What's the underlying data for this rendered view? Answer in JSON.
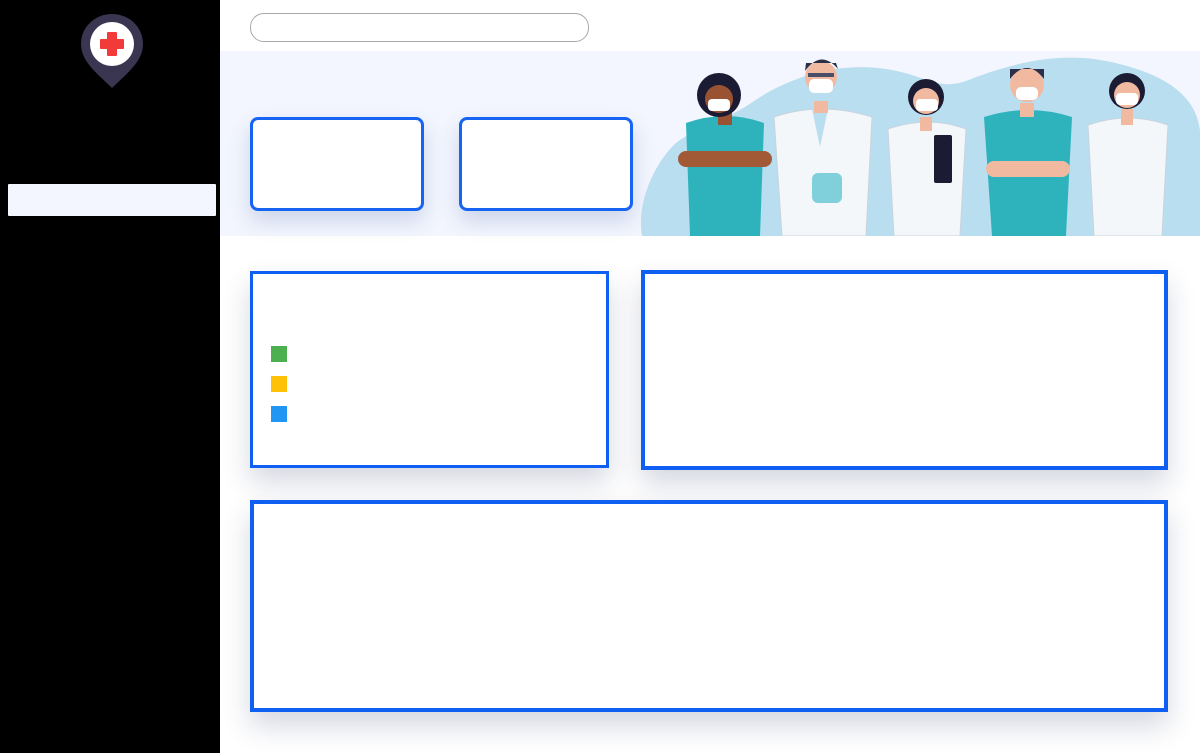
{
  "app": {
    "brand_color": "#0f60f2",
    "sidebar_color": "#000000",
    "banner_bg": "#f3f6fe"
  },
  "sidebar": {
    "logo_icon": "map-pin-medical-cross-icon",
    "active_item": {
      "label": ""
    }
  },
  "search": {
    "placeholder": "",
    "value": ""
  },
  "stats": [
    {
      "label": "",
      "value": ""
    },
    {
      "label": "",
      "value": ""
    }
  ],
  "chart_card": {
    "title": "",
    "legend": [
      {
        "label": "",
        "color": "#4caf50"
      },
      {
        "label": "",
        "color": "#ffc107"
      },
      {
        "label": "",
        "color": "#2196f3"
      }
    ]
  },
  "right_card": {
    "title": ""
  },
  "bottom_card": {
    "title": ""
  },
  "banner": {
    "illustration": "medical-staff-group-illustration"
  }
}
